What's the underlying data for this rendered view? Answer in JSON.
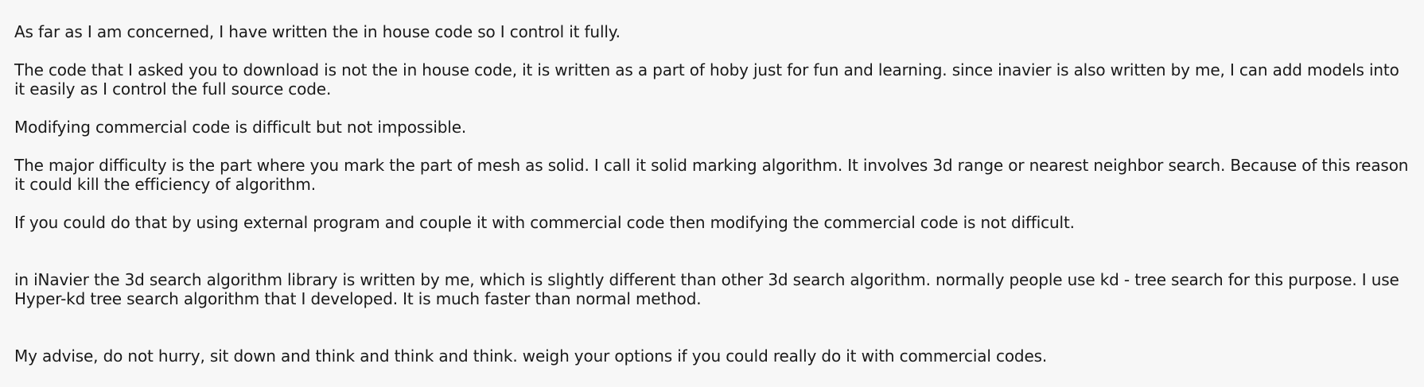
{
  "post": {
    "paragraphs": [
      "As far as I am concerned, I have written the in house code so I control it fully.",
      "The code that I asked you to download is not the in house code, it is written as a part of hoby just for fun and learning. since inavier is also written by me, I can add models into it easily as I control the full source code.",
      "Modifying commercial code is difficult but not impossible.",
      "The major difficulty is the part where you mark the part of mesh as solid. I call it solid marking algorithm. It involves 3d range or nearest neighbor search. Because of this reason it could kill the efficiency of algorithm.",
      "If you could do that by using external program and couple it with commercial code then modifying the commercial code is not difficult.",
      "in iNavier the 3d search algorithm library is written by me, which is slightly different than other 3d search algorithm. normally people use kd - tree search for this purpose. I use Hyper-kd tree search algorithm that I developed. It is much faster than normal method.",
      "My advise, do not hurry, sit down and think and think and think. weigh your options if you could really do it with commercial codes."
    ]
  }
}
